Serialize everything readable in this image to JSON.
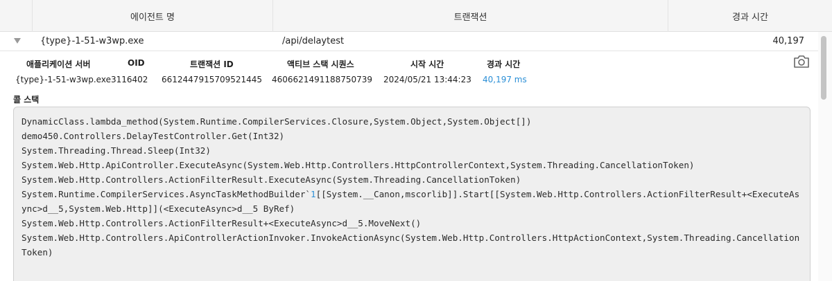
{
  "header": {
    "col_agent": "에이전트 명",
    "col_transaction": "트랜잭션",
    "col_elapsed": "경과 시간"
  },
  "row": {
    "agent": "{type}-1-51-w3wp.exe",
    "transaction": "/api/delaytest",
    "elapsed": "40,197"
  },
  "detail": {
    "headers": {
      "app_server": "애플리케이션 서버",
      "oid": "OID",
      "txid": "트랜잭션 ID",
      "active_stack": "액티브 스택 시퀀스",
      "start_time": "시작 시간",
      "elapsed": "경과 시간"
    },
    "values": {
      "app_server": "{type}-1-51-w3wp.exe",
      "oid": "3116402",
      "txid": "6612447915709521445",
      "active_stack": "4606621491188750739",
      "start_time": "2024/05/21 13:44:23",
      "elapsed": "40,197 ms"
    }
  },
  "call_stack": {
    "title": "콜 스택",
    "line0": "DynamicClass.lambda_method(System.Runtime.CompilerServices.Closure,System.Object,System.Object[])",
    "line1": "demo450.Controllers.DelayTestController.Get(Int32)",
    "line2": "System.Threading.Thread.Sleep(Int32)",
    "line3": "System.Web.Http.ApiController.ExecuteAsync(System.Web.Http.Controllers.HttpControllerContext,System.Threading.CancellationToken)",
    "line4": "System.Web.Http.Controllers.ActionFilterResult.ExecuteAsync(System.Threading.CancellationToken)",
    "line5_a": "System.Runtime.CompilerServices.AsyncTaskMethodBuilder`",
    "line5_num": "1",
    "line5_b": "[[System.__Canon,mscorlib]].Start[[System.Web.Http.Controllers.ActionFilterResult+<ExecuteAsync>d__5,System.Web.Http]](<ExecuteAsync>d__5 ByRef)",
    "line6": "System.Web.Http.Controllers.ActionFilterResult+<ExecuteAsync>d__5.MoveNext()",
    "line7": "System.Web.Http.Controllers.ApiControllerActionInvoker.InvokeActionAsync(System.Web.Http.Controllers.HttpActionContext,System.Threading.CancellationToken)"
  },
  "icons": {
    "expand": "chevron-down-icon",
    "screenshot": "camera-icon"
  },
  "colors": {
    "link": "#2b8fd6",
    "header_bg": "#f5f5f5",
    "stack_bg": "#efefef"
  }
}
